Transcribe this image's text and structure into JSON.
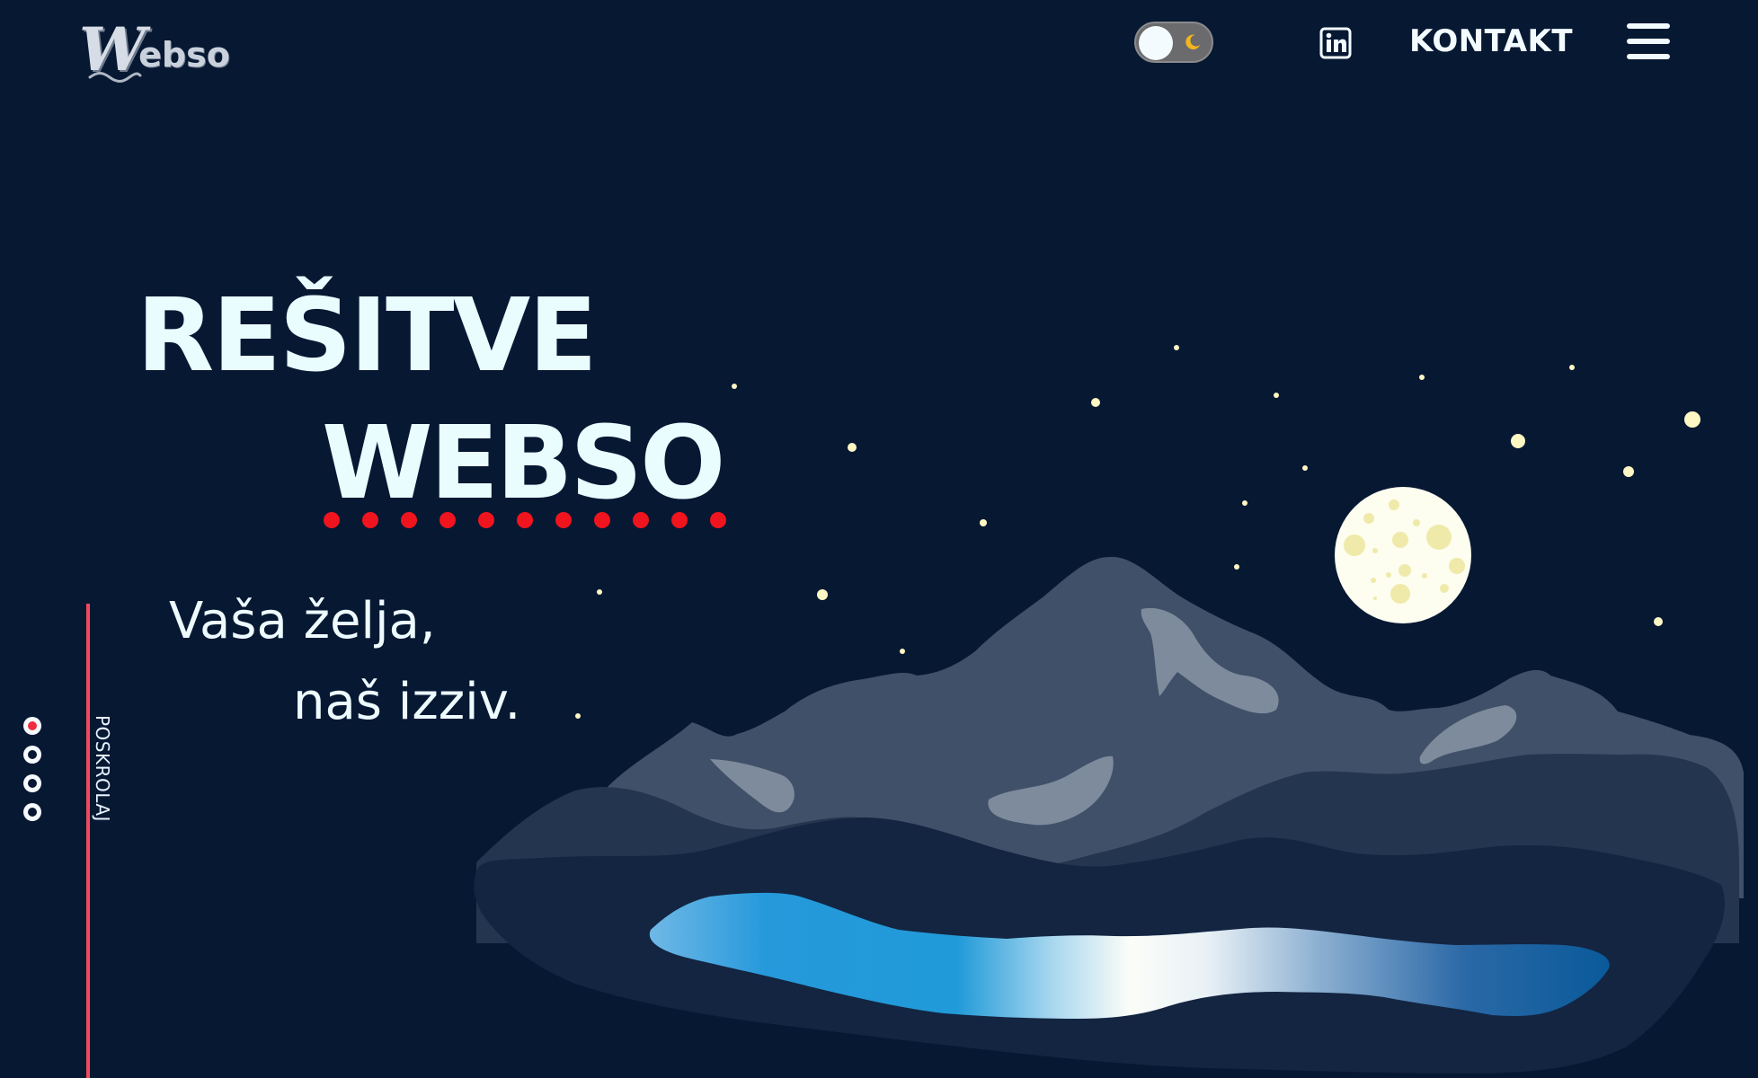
{
  "header": {
    "logo": {
      "initial": "W",
      "rest": "ebso"
    },
    "theme_toggle": {
      "mode": "dark",
      "knob_color": "#f4fbff",
      "moon_color": "#f3b51c",
      "icon": "moon-icon"
    },
    "social": {
      "icon": "linkedin-icon"
    },
    "nav": {
      "contact_label": "KONTAKT"
    },
    "menu": {
      "icon": "hamburger-icon"
    }
  },
  "hero": {
    "title_line1": "REŠITVE",
    "title_line2": "WEBSO",
    "underline_dot_count": 11,
    "underline_color": "#f0141e",
    "tagline_line1": "Vaša želja,",
    "tagline_line2": "naš izziv."
  },
  "side": {
    "scroll_label": "POSKROLAJ",
    "line_color": "#f04a5c",
    "section_dots": 4,
    "active_section": 1
  },
  "colors": {
    "background": "#071833",
    "text": "#e9fdff",
    "moon": "#fdfdf0",
    "lake_light": "#f4fbff",
    "lake_blue": "#1f95d6"
  }
}
